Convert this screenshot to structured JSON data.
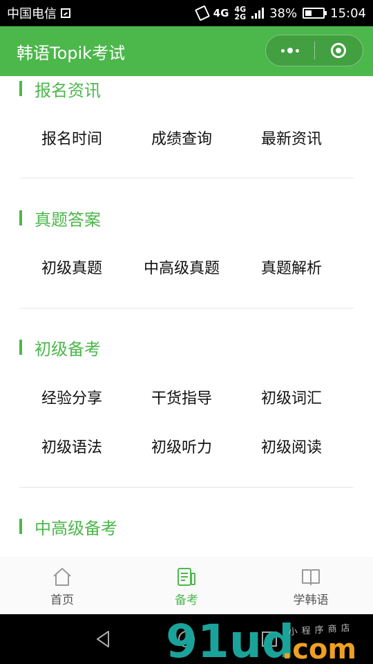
{
  "status_bar": {
    "carrier": "中国电信",
    "network_main": "4G",
    "network_top": "4G",
    "network_bottom": "2G",
    "battery_percent": "38%",
    "battery_level": 0.38,
    "time": "15:04"
  },
  "header": {
    "title": "韩语Topik考试"
  },
  "sections": [
    {
      "title": "报名资讯",
      "items": [
        "报名时间",
        "成绩查询",
        "最新资讯"
      ]
    },
    {
      "title": "真题答案",
      "items": [
        "初级真题",
        "中高级真题",
        "真题解析"
      ]
    },
    {
      "title": "初级备考",
      "items": [
        "经验分享",
        "干货指导",
        "初级词汇",
        "初级语法",
        "初级听力",
        "初级阅读"
      ]
    },
    {
      "title": "中高级备考",
      "items": []
    }
  ],
  "tab_bar": {
    "tabs": [
      {
        "label": "首页",
        "icon": "home-icon"
      },
      {
        "label": "备考",
        "icon": "notes-icon",
        "active": true
      },
      {
        "label": "学韩语",
        "icon": "book-icon"
      }
    ]
  },
  "colors": {
    "brand_green": "#4cb74b",
    "tab_inactive": "#888888"
  },
  "watermark": {
    "text_main": "91ud",
    "text_suffix": ".com",
    "text_small": "小程序商店"
  }
}
